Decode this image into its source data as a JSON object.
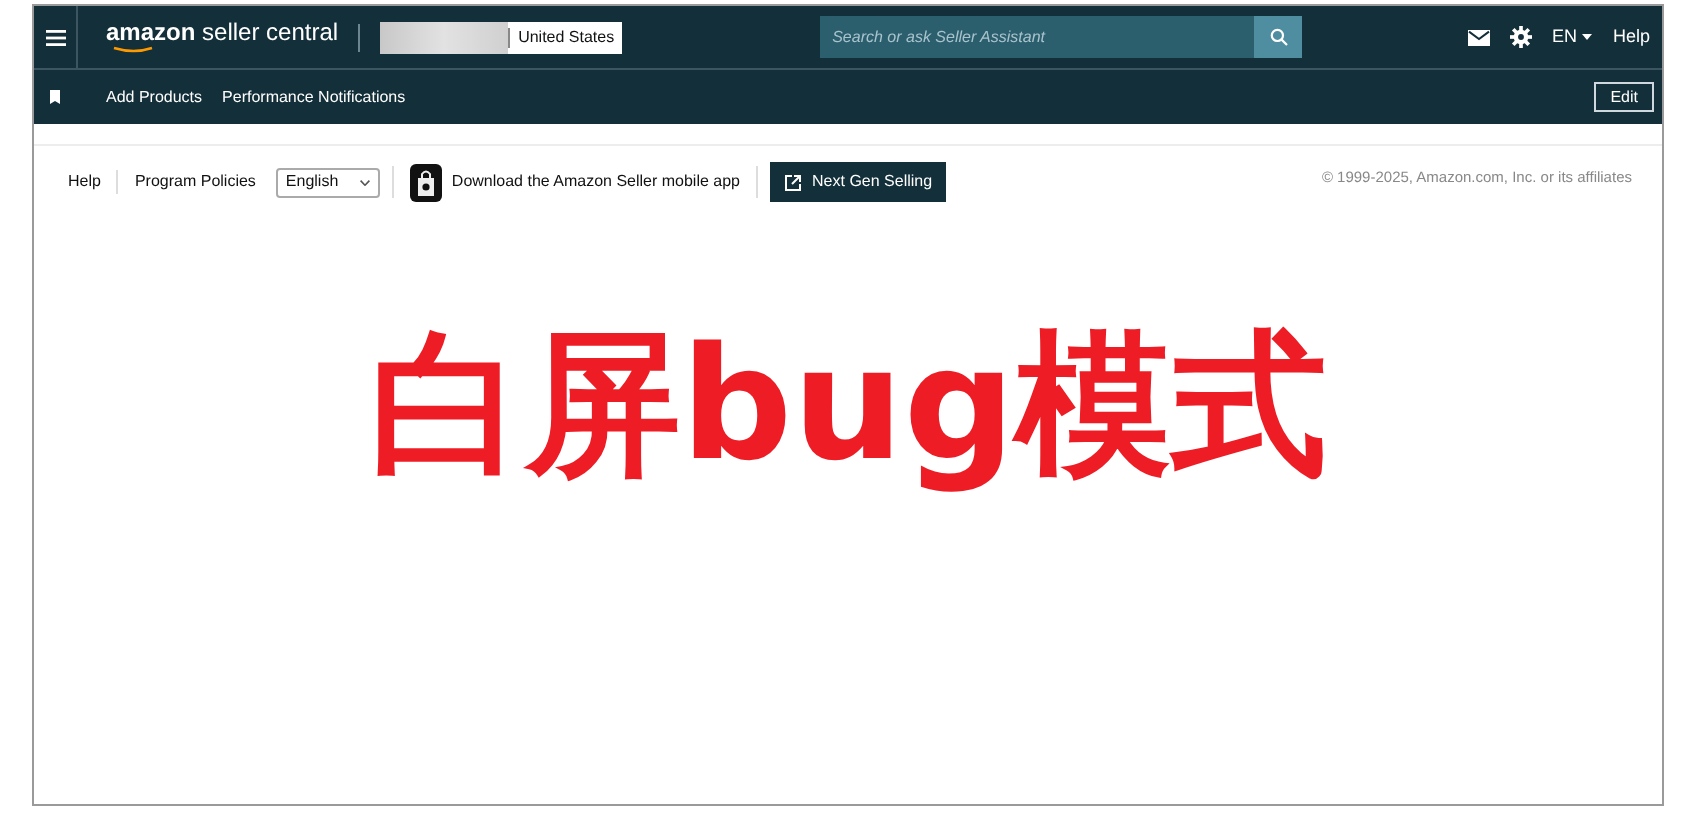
{
  "top_bar": {
    "logo": "**amazon** seller central",
    "marketplace": "United States",
    "search": {
      "placeholder": "Search or ask Seller Assistant"
    },
    "language": "EN",
    "help": "Help"
  },
  "nav_bar": {
    "items": [
      "Add Products",
      "Performance Notifications"
    ],
    "edit": "Edit"
  },
  "footer": {
    "links": [
      "Help",
      "Program Policies"
    ],
    "language_select": "English",
    "app_link": "Download the Amazon Seller mobile app",
    "next_gen_button": "Next Gen Selling",
    "copyright": "© 1999-2025, Amazon.com, Inc. or its affiliates"
  },
  "overlay_text": "白屏bug模式"
}
